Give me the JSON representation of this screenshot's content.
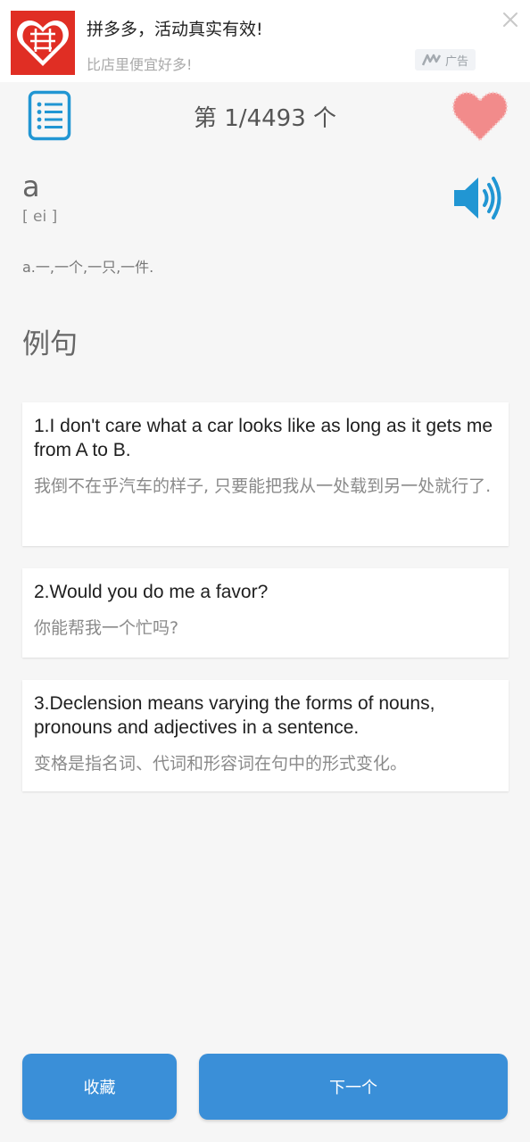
{
  "ad": {
    "title": "拼多多，活动真实有效!",
    "subtitle": "比店里便宜好多!",
    "badge": "广告",
    "logo_text": "拼",
    "close_icon": "close-icon",
    "brand_color": "#e02e24"
  },
  "header": {
    "counter": "第 1/4493 个",
    "menu_icon": "list-icon",
    "favorite_icon": "heart-icon"
  },
  "word": {
    "text": "a",
    "phonetic": "[ ei ]",
    "definition": "a.一,一个,一只,一件.",
    "speaker_icon": "speaker-icon"
  },
  "examples": {
    "title": "例句",
    "items": [
      {
        "en": "1.I don't care what a car looks like as long as it gets me from A to B.",
        "cn": "我倒不在乎汽车的样子, 只要能把我从一处载到另一处就行了."
      },
      {
        "en": "2.Would you do me a favor?",
        "cn": "你能帮我一个忙吗?"
      },
      {
        "en": "3.Declension means varying the forms of nouns, pronouns and adjectives in a sentence.",
        "cn": "变格是指名词、代词和形容词在句中的形式变化。"
      }
    ]
  },
  "actions": {
    "favorite_label": "收藏",
    "next_label": "下一个"
  },
  "colors": {
    "accent": "#3a8fd8",
    "icon_blue": "#2196d3",
    "heart": "#f28b8b"
  }
}
